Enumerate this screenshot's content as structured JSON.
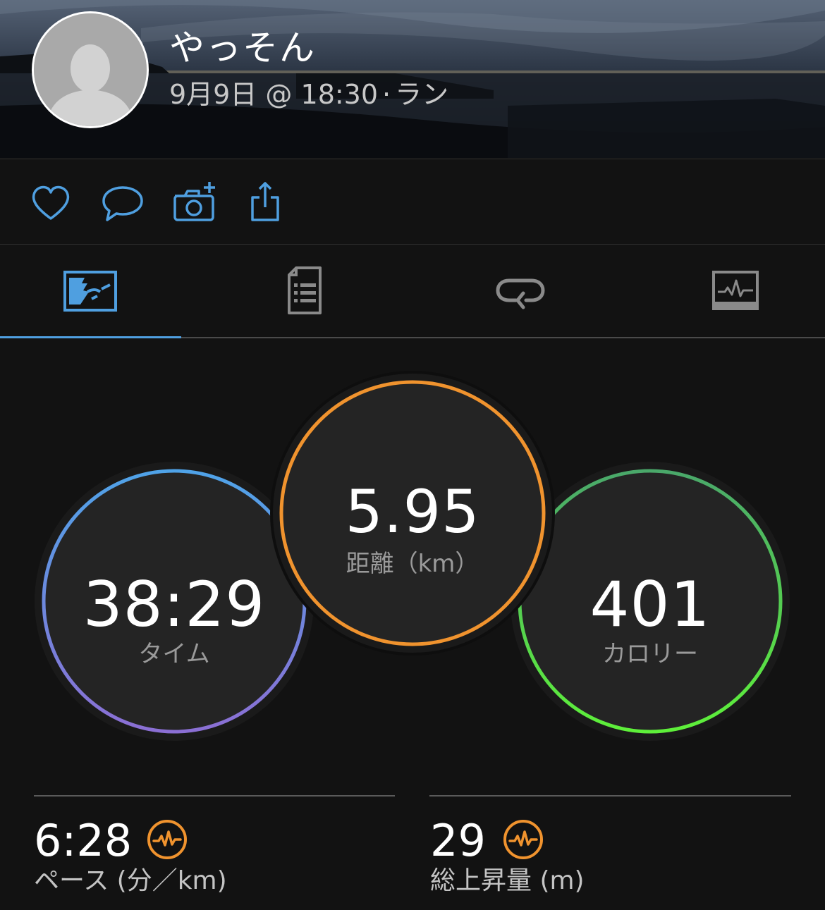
{
  "header": {
    "user_name": "やっそん",
    "date": "9月9日 @ 18:30",
    "separator": "·",
    "activity_type": "ラン"
  },
  "actions": [
    {
      "icon": "heart-icon"
    },
    {
      "icon": "comment-icon"
    },
    {
      "icon": "add-photo-icon"
    },
    {
      "icon": "share-icon"
    }
  ],
  "tabs": [
    {
      "icon": "map-overview-icon",
      "selected": true
    },
    {
      "icon": "details-list-icon",
      "selected": false
    },
    {
      "icon": "laps-icon",
      "selected": false
    },
    {
      "icon": "chart-icon",
      "selected": false
    }
  ],
  "stats": {
    "time": {
      "value": "38:29",
      "label": "タイム"
    },
    "distance": {
      "value": "5.95",
      "label": "距離（km）"
    },
    "calories": {
      "value": "401",
      "label": "カロリー"
    }
  },
  "metrics": {
    "pace": {
      "value": "6:28",
      "label": "ペース (分／km)"
    },
    "elevation": {
      "value": "29",
      "label": "総上昇量 (m)"
    }
  },
  "colors": {
    "accent": "#4f9fe0",
    "time_ring_start": "#4fa3e8",
    "time_ring_end": "#8b6fd4",
    "distance_ring": "#f0932e",
    "calories_ring_start": "#4aa86a",
    "calories_ring_end": "#5ef03a",
    "metric_icon": "#f0932e"
  }
}
